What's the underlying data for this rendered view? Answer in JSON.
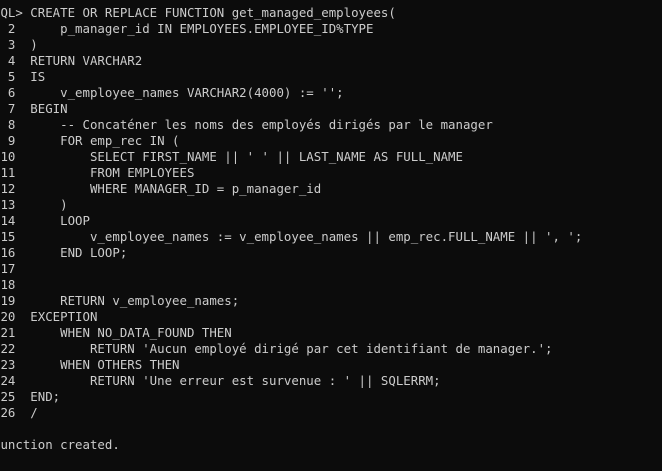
{
  "terminal": {
    "lines": [
      "SQL> CREATE OR REPLACE FUNCTION get_managed_employees(",
      "  2      p_manager_id IN EMPLOYEES.EMPLOYEE_ID%TYPE",
      "  3  )",
      "  4  RETURN VARCHAR2",
      "  5  IS",
      "  6      v_employee_names VARCHAR2(4000) := '';",
      "  7  BEGIN",
      "  8      -- Concaténer les noms des employés dirigés par le manager",
      "  9      FOR emp_rec IN (",
      " 10          SELECT FIRST_NAME || ' ' || LAST_NAME AS FULL_NAME",
      " 11          FROM EMPLOYEES",
      " 12          WHERE MANAGER_ID = p_manager_id",
      " 13      )",
      " 14      LOOP",
      " 15          v_employee_names := v_employee_names || emp_rec.FULL_NAME || ', ';",
      " 16      END LOOP;",
      " 17",
      " 18",
      " 19      RETURN v_employee_names;",
      " 20  EXCEPTION",
      " 21      WHEN NO_DATA_FOUND THEN",
      " 22          RETURN 'Aucun employé dirigé par cet identifiant de manager.';",
      " 23      WHEN OTHERS THEN",
      " 24          RETURN 'Une erreur est survenue : ' || SQLERRM;",
      " 25  END;",
      " 26  /",
      "",
      "Function created."
    ]
  }
}
